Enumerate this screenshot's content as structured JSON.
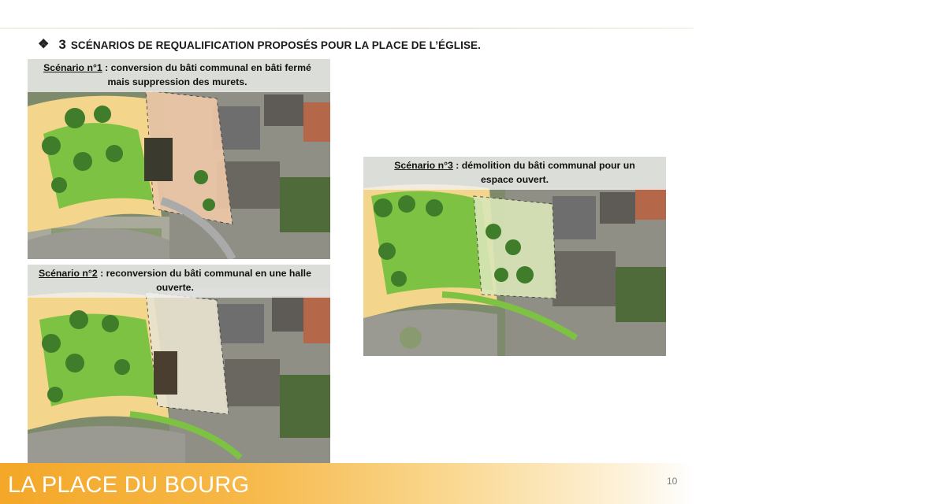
{
  "heading": {
    "bullet": "❖",
    "number": "3",
    "text": "SCÉNARIOS DE REQUALIFICATION PROPOSÉS POUR LA PLACE DE L’ÉGLISE."
  },
  "scenarios": [
    {
      "label": "Scénario n°1",
      "text": " : conversion du bâti communal en bâti fermé mais suppression des murets."
    },
    {
      "label": "Scénario n°2",
      "text": " : reconversion du bâti communal en une halle ouverte."
    },
    {
      "label": "Scénario n°3",
      "text": " : démolition du bâti communal pour un espace ouvert."
    }
  ],
  "footer": {
    "title": "LA PLACE DU BOURG",
    "page_number": "10"
  },
  "colors": {
    "footer_orange": "#f4a728",
    "greenery": "#7dc242",
    "paving": "#f5d98a"
  }
}
